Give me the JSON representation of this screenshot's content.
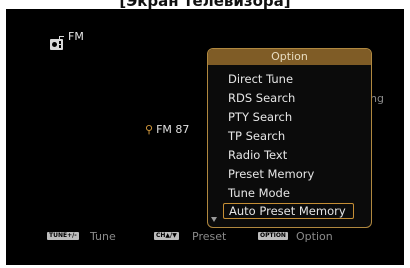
{
  "caption": "[Экран телевизора]",
  "source": {
    "icon": "radio-icon",
    "band": "FM"
  },
  "station": {
    "pin_icon": "pin-icon",
    "pin_glyph": "⚲",
    "frequency": "FM 87"
  },
  "background_partial": "ng",
  "option_menu": {
    "title": "Option",
    "items": [
      "Direct Tune",
      "RDS Search",
      "PTY Search",
      "TP Search",
      "Radio Text",
      "Preset Memory",
      "Tune Mode",
      "Auto Preset Memory"
    ],
    "selected": "Auto Preset Memory",
    "scroll_icon": "scroll-down-icon"
  },
  "hints": {
    "tune_key": "TUNE+/-",
    "tune_label": "Tune",
    "preset_key": "CH▲/▼",
    "preset_label": "Preset",
    "option_key": "OPTION",
    "option_label": "Option"
  },
  "colors": {
    "accent": "#c58e35",
    "title_bar": "#7f5c26",
    "screen": "#000000"
  }
}
